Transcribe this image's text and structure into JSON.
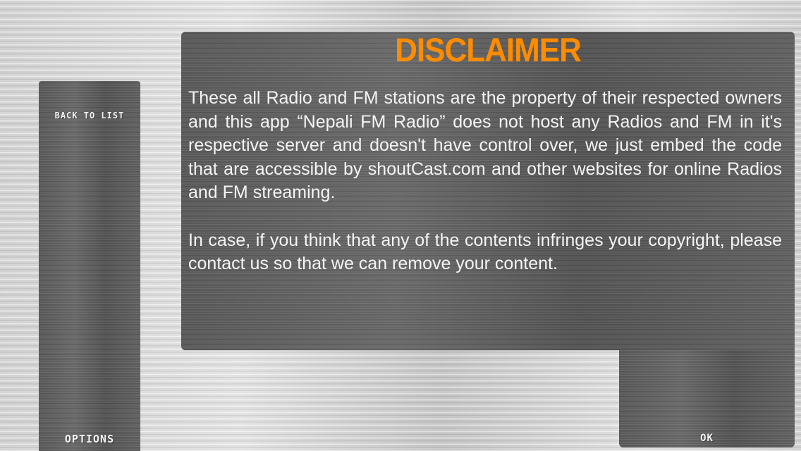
{
  "sidebar": {
    "back_label": "BACK TO LIST",
    "options_label": "OPTIONS"
  },
  "dialog": {
    "title": "DISCLAIMER",
    "paragraphs": [
      "These all Radio and FM stations are the property of their respected owners and this app “Nepali FM Radio” does not host any Radios and FM in it's respective server and doesn't have control over, we just embed the code that are accessible by shoutCast.com and other websites for online Radios and FM streaming.",
      "In case, if you think that any of the contents infringes your copyright, please contact us so that we can remove your content."
    ],
    "ok_label": "OK"
  },
  "colors": {
    "title_accent": "#ff8c00",
    "panel": "#5b5b5b",
    "text": "#f4f4f4"
  }
}
